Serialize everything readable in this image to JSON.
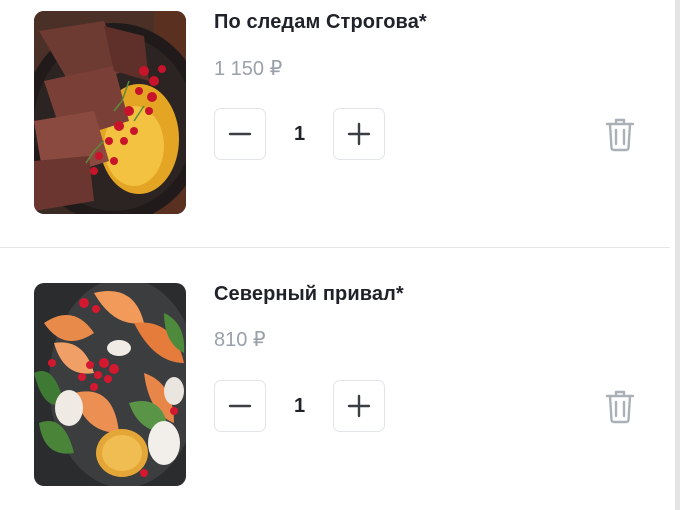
{
  "cart": {
    "items": [
      {
        "name": "По следам Строгова*",
        "price": "1 150 ₽",
        "quantity": "1",
        "minus_icon": "minus-icon",
        "plus_icon": "plus-icon",
        "delete_icon": "trash-icon"
      },
      {
        "name": "Северный привал*",
        "price": "810 ₽",
        "quantity": "1",
        "minus_icon": "minus-icon",
        "plus_icon": "plus-icon",
        "delete_icon": "trash-icon"
      }
    ]
  },
  "colors": {
    "text": "#1f2329",
    "price": "#9aa1aa",
    "icon": "#3a3f45",
    "trash": "#a9b0b8",
    "border": "#e1e4e8"
  }
}
